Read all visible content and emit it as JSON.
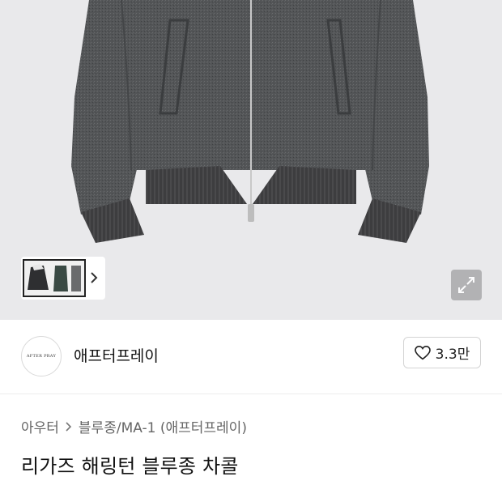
{
  "gallery": {
    "image_alt": "charcoal herringbone wool blouson jacket",
    "thumbnail_next_icon": "chevron-right-icon",
    "expand_icon": "expand-arrows-icon"
  },
  "seller": {
    "logo_text": "AFTER PRAY",
    "name": "애프터프레이",
    "like_icon": "heart-outline-icon",
    "like_count": "3.3만"
  },
  "breadcrumb": {
    "items": [
      "아우터",
      "블루종/MA-1 (애프터프레이)"
    ],
    "separator_icon": "chevron-right-icon"
  },
  "product": {
    "title": "리가즈 해링턴 블루종 차콜"
  },
  "colors": {
    "hero_bg": "#e9e9eb",
    "jacket": "#4f5153",
    "rib": "#3c3c3e"
  }
}
